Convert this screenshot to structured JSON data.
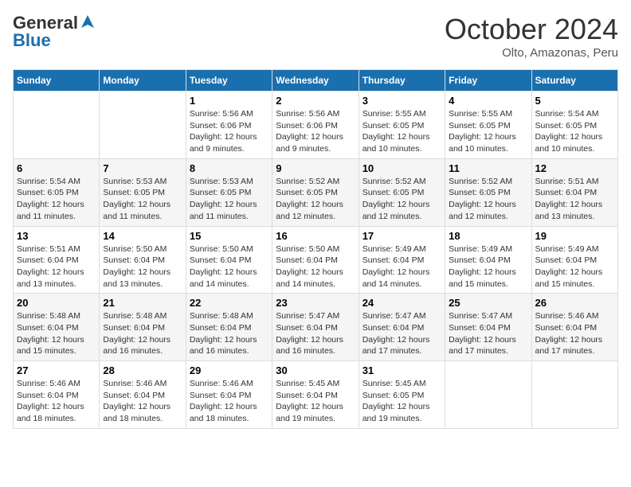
{
  "logo": {
    "line1": "General",
    "line2": "Blue"
  },
  "title": "October 2024",
  "subtitle": "Olto, Amazonas, Peru",
  "days_header": [
    "Sunday",
    "Monday",
    "Tuesday",
    "Wednesday",
    "Thursday",
    "Friday",
    "Saturday"
  ],
  "weeks": [
    [
      {
        "num": "",
        "info": ""
      },
      {
        "num": "",
        "info": ""
      },
      {
        "num": "1",
        "info": "Sunrise: 5:56 AM\nSunset: 6:06 PM\nDaylight: 12 hours and 9 minutes."
      },
      {
        "num": "2",
        "info": "Sunrise: 5:56 AM\nSunset: 6:06 PM\nDaylight: 12 hours and 9 minutes."
      },
      {
        "num": "3",
        "info": "Sunrise: 5:55 AM\nSunset: 6:05 PM\nDaylight: 12 hours and 10 minutes."
      },
      {
        "num": "4",
        "info": "Sunrise: 5:55 AM\nSunset: 6:05 PM\nDaylight: 12 hours and 10 minutes."
      },
      {
        "num": "5",
        "info": "Sunrise: 5:54 AM\nSunset: 6:05 PM\nDaylight: 12 hours and 10 minutes."
      }
    ],
    [
      {
        "num": "6",
        "info": "Sunrise: 5:54 AM\nSunset: 6:05 PM\nDaylight: 12 hours and 11 minutes."
      },
      {
        "num": "7",
        "info": "Sunrise: 5:53 AM\nSunset: 6:05 PM\nDaylight: 12 hours and 11 minutes."
      },
      {
        "num": "8",
        "info": "Sunrise: 5:53 AM\nSunset: 6:05 PM\nDaylight: 12 hours and 11 minutes."
      },
      {
        "num": "9",
        "info": "Sunrise: 5:52 AM\nSunset: 6:05 PM\nDaylight: 12 hours and 12 minutes."
      },
      {
        "num": "10",
        "info": "Sunrise: 5:52 AM\nSunset: 6:05 PM\nDaylight: 12 hours and 12 minutes."
      },
      {
        "num": "11",
        "info": "Sunrise: 5:52 AM\nSunset: 6:05 PM\nDaylight: 12 hours and 12 minutes."
      },
      {
        "num": "12",
        "info": "Sunrise: 5:51 AM\nSunset: 6:04 PM\nDaylight: 12 hours and 13 minutes."
      }
    ],
    [
      {
        "num": "13",
        "info": "Sunrise: 5:51 AM\nSunset: 6:04 PM\nDaylight: 12 hours and 13 minutes."
      },
      {
        "num": "14",
        "info": "Sunrise: 5:50 AM\nSunset: 6:04 PM\nDaylight: 12 hours and 13 minutes."
      },
      {
        "num": "15",
        "info": "Sunrise: 5:50 AM\nSunset: 6:04 PM\nDaylight: 12 hours and 14 minutes."
      },
      {
        "num": "16",
        "info": "Sunrise: 5:50 AM\nSunset: 6:04 PM\nDaylight: 12 hours and 14 minutes."
      },
      {
        "num": "17",
        "info": "Sunrise: 5:49 AM\nSunset: 6:04 PM\nDaylight: 12 hours and 14 minutes."
      },
      {
        "num": "18",
        "info": "Sunrise: 5:49 AM\nSunset: 6:04 PM\nDaylight: 12 hours and 15 minutes."
      },
      {
        "num": "19",
        "info": "Sunrise: 5:49 AM\nSunset: 6:04 PM\nDaylight: 12 hours and 15 minutes."
      }
    ],
    [
      {
        "num": "20",
        "info": "Sunrise: 5:48 AM\nSunset: 6:04 PM\nDaylight: 12 hours and 15 minutes."
      },
      {
        "num": "21",
        "info": "Sunrise: 5:48 AM\nSunset: 6:04 PM\nDaylight: 12 hours and 16 minutes."
      },
      {
        "num": "22",
        "info": "Sunrise: 5:48 AM\nSunset: 6:04 PM\nDaylight: 12 hours and 16 minutes."
      },
      {
        "num": "23",
        "info": "Sunrise: 5:47 AM\nSunset: 6:04 PM\nDaylight: 12 hours and 16 minutes."
      },
      {
        "num": "24",
        "info": "Sunrise: 5:47 AM\nSunset: 6:04 PM\nDaylight: 12 hours and 17 minutes."
      },
      {
        "num": "25",
        "info": "Sunrise: 5:47 AM\nSunset: 6:04 PM\nDaylight: 12 hours and 17 minutes."
      },
      {
        "num": "26",
        "info": "Sunrise: 5:46 AM\nSunset: 6:04 PM\nDaylight: 12 hours and 17 minutes."
      }
    ],
    [
      {
        "num": "27",
        "info": "Sunrise: 5:46 AM\nSunset: 6:04 PM\nDaylight: 12 hours and 18 minutes."
      },
      {
        "num": "28",
        "info": "Sunrise: 5:46 AM\nSunset: 6:04 PM\nDaylight: 12 hours and 18 minutes."
      },
      {
        "num": "29",
        "info": "Sunrise: 5:46 AM\nSunset: 6:04 PM\nDaylight: 12 hours and 18 minutes."
      },
      {
        "num": "30",
        "info": "Sunrise: 5:45 AM\nSunset: 6:04 PM\nDaylight: 12 hours and 19 minutes."
      },
      {
        "num": "31",
        "info": "Sunrise: 5:45 AM\nSunset: 6:05 PM\nDaylight: 12 hours and 19 minutes."
      },
      {
        "num": "",
        "info": ""
      },
      {
        "num": "",
        "info": ""
      }
    ]
  ]
}
